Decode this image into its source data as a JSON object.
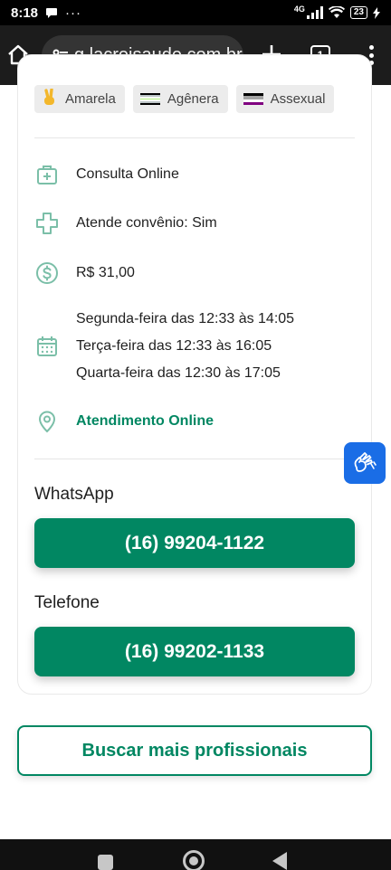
{
  "status_bar": {
    "time": "8:18",
    "network": "4G",
    "battery": "23"
  },
  "browser": {
    "url": "g.lacreisaude.com.br",
    "tab_count": "1"
  },
  "chips": [
    {
      "label": "Amarela",
      "icon": "victory-hand-emoji"
    },
    {
      "label": "Agênera",
      "icon": "agender-flag",
      "colors": [
        "#000000",
        "#bcc4c6",
        "#ffffff",
        "#b5f582",
        "#ffffff",
        "#bcc4c6",
        "#000000"
      ]
    },
    {
      "label": "Assexual",
      "icon": "asexual-flag",
      "colors": [
        "#000000",
        "#a3a3a3",
        "#ffffff",
        "#800080"
      ]
    }
  ],
  "info": {
    "consultation": "Consulta Online",
    "insurance": "Atende convênio: Sim",
    "price": "R$ 31,00",
    "schedule": [
      "Segunda-feira das 12:33 às 14:05",
      "Terça-feira das 12:33 às 16:05",
      "Quarta-feira das 12:30 às 17:05"
    ],
    "location": "Atendimento Online"
  },
  "contacts": {
    "whatsapp_title": "WhatsApp",
    "whatsapp_number": "(16) 99204-1122",
    "phone_title": "Telefone",
    "phone_number": "(16) 99202-1133"
  },
  "actions": {
    "search_more": "Buscar mais profissionais"
  },
  "colors": {
    "brand_green": "#018762",
    "accessibility_blue": "#1a6de6",
    "icon_green": "#7bbfa8"
  }
}
